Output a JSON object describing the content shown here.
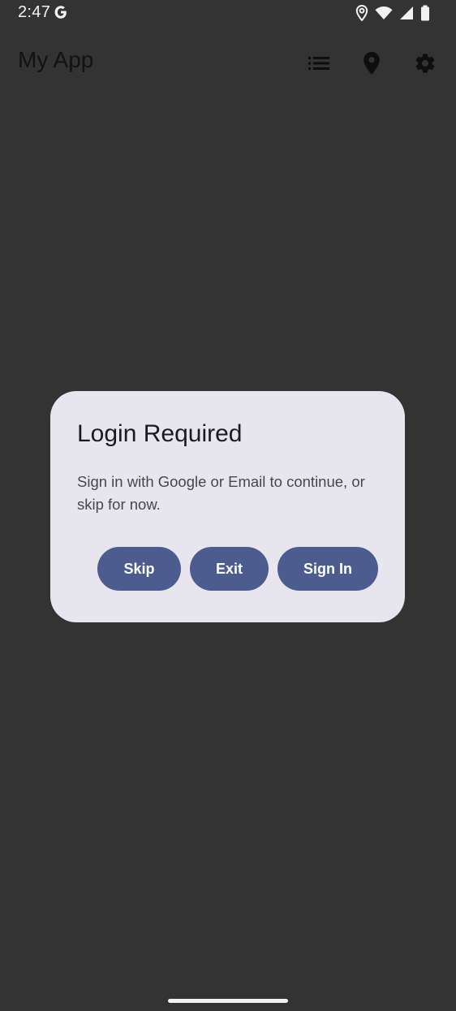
{
  "status_bar": {
    "time": "2:47",
    "icons": [
      "google-g-icon",
      "location-icon",
      "wifi-icon",
      "signal-icon",
      "battery-icon"
    ]
  },
  "app_bar": {
    "title": "My App",
    "actions": [
      "list-icon",
      "location-pin-icon",
      "settings-gear-icon"
    ]
  },
  "dialog": {
    "title": "Login Required",
    "message": "Sign in with Google or Email to continue, or skip for now.",
    "buttons": {
      "skip": "Skip",
      "exit": "Exit",
      "sign_in": "Sign In"
    }
  },
  "colors": {
    "scrim_background": "#333333",
    "dialog_surface": "#e7e6ee",
    "button_primary": "#4c5c8f",
    "button_text": "#ffffff"
  }
}
